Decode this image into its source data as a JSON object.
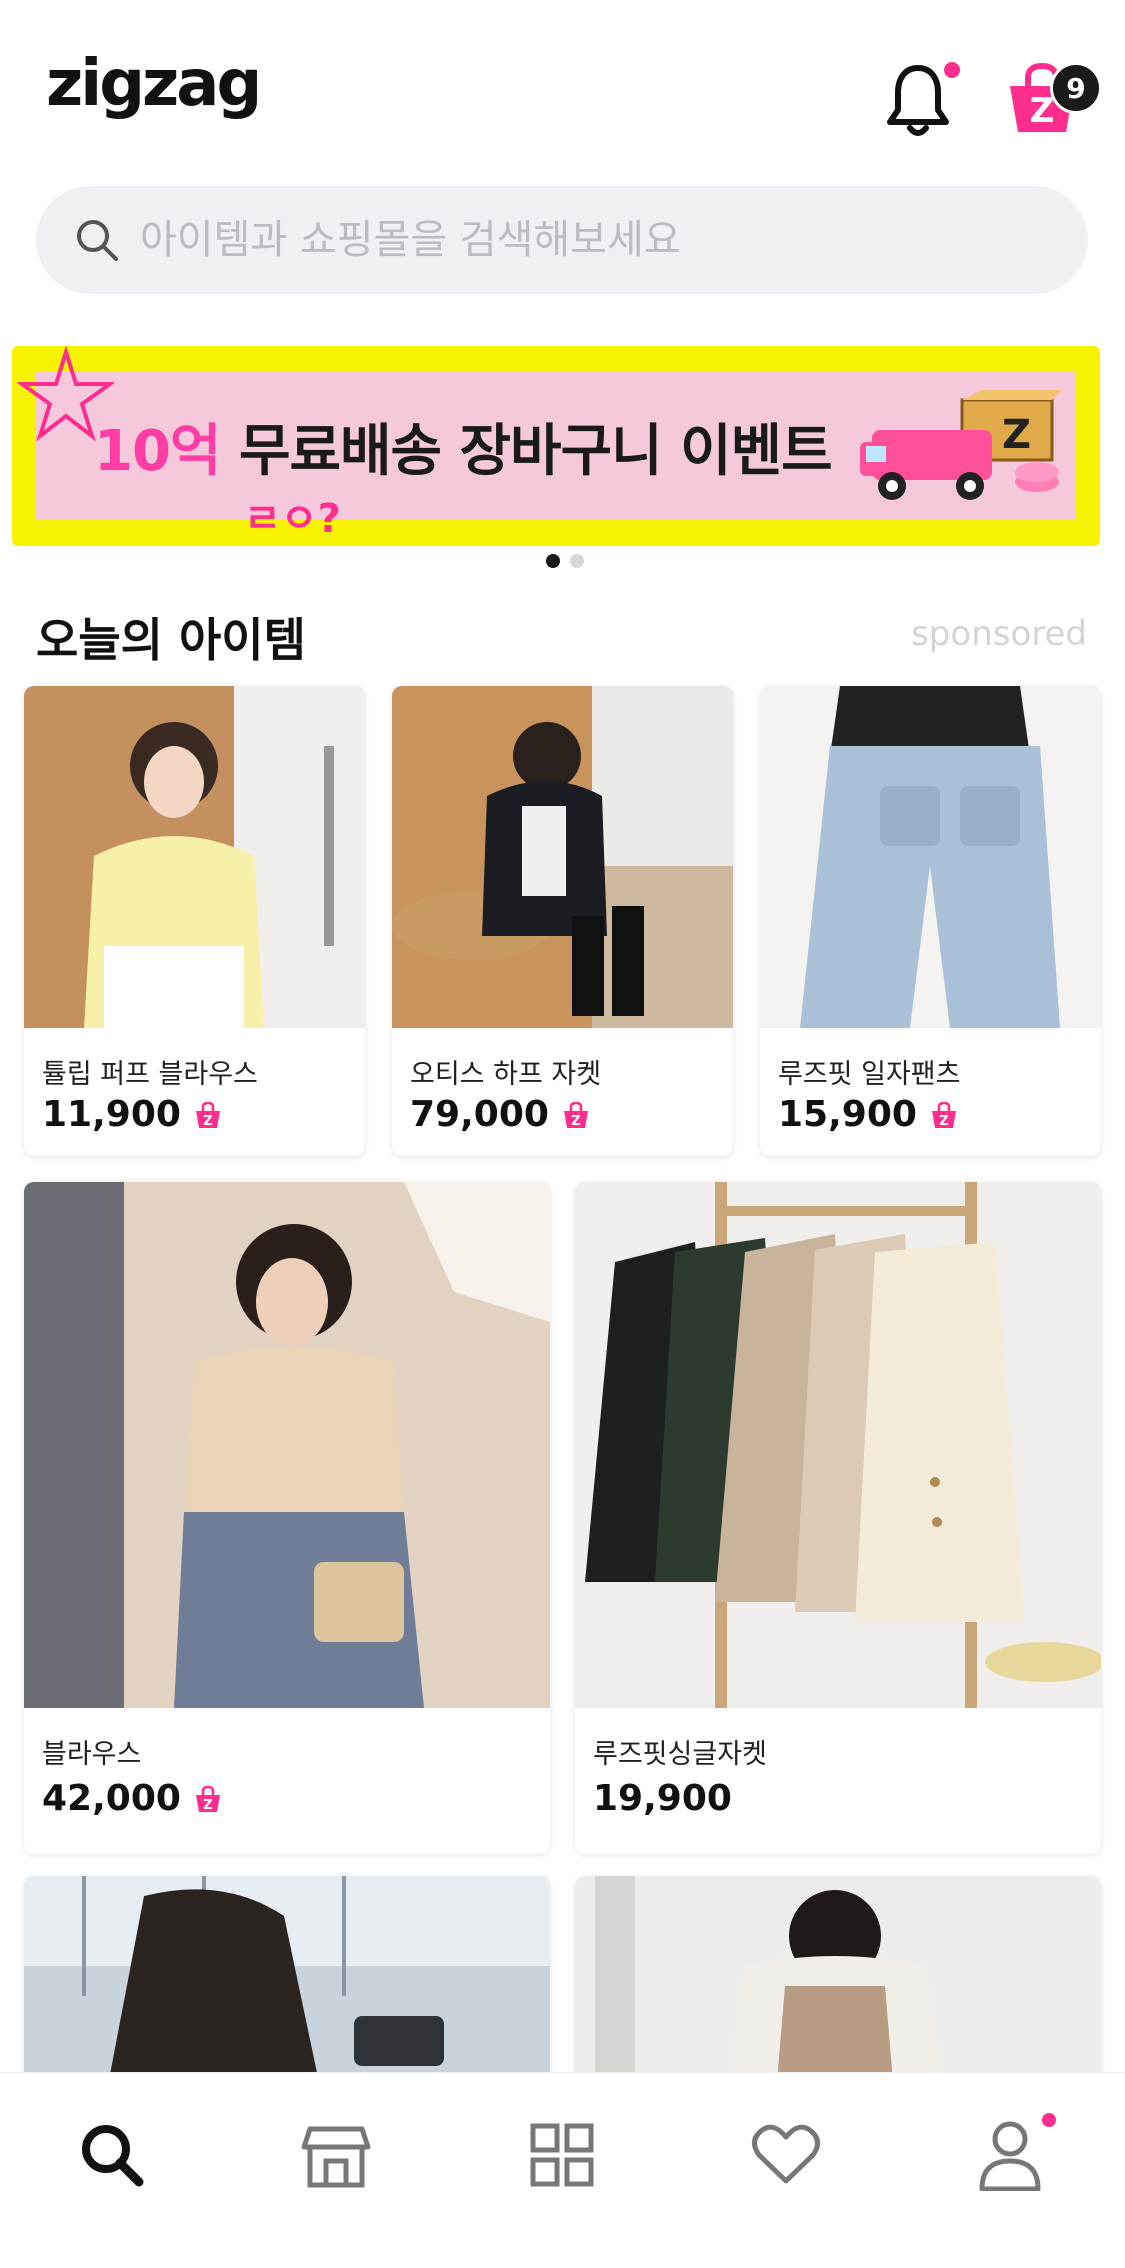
{
  "header": {
    "logo": "zigzag",
    "cart_count": "9"
  },
  "search": {
    "placeholder": "아이템과 쇼핑몰을 검색해보세요"
  },
  "banner": {
    "highlight": "10억",
    "title": "무료배송 장바구니 이벤트",
    "doodle": "ㄹㅇ?",
    "page_count": 2,
    "active_page": 1
  },
  "section": {
    "title": "오늘의 아이템",
    "sponsored_label": "sponsored"
  },
  "products": [
    {
      "name": "튤립 퍼프 블라우스",
      "price": "11,900",
      "zpay": true
    },
    {
      "name": "오티스 하프 자켓",
      "price": "79,000",
      "zpay": true
    },
    {
      "name": "루즈핏 일자팬츠",
      "price": "15,900",
      "zpay": true
    },
    {
      "name": "블라우스",
      "price": "42,000",
      "zpay": true
    },
    {
      "name": "루즈핏싱글자켓",
      "price": "19,900",
      "zpay": false
    }
  ],
  "bottom_nav": [
    {
      "icon": "search-icon",
      "active": true
    },
    {
      "icon": "store-icon",
      "active": false
    },
    {
      "icon": "category-grid-icon",
      "active": false
    },
    {
      "icon": "heart-icon",
      "active": false
    },
    {
      "icon": "profile-icon",
      "active": false,
      "badge": true
    }
  ],
  "colors": {
    "accent": "#ff2e8e",
    "banner_yellow": "#f7f200",
    "banner_pink": "#f5c8dc"
  }
}
